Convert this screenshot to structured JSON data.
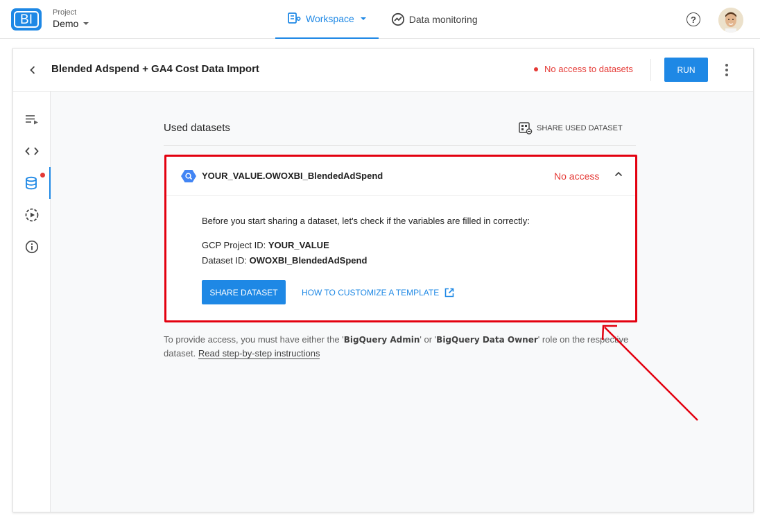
{
  "topbar": {
    "logo_text": "BI",
    "project_label": "Project",
    "project_name": "Demo",
    "nav": [
      {
        "label": "Workspace",
        "icon": "workspace-icon",
        "active": true
      },
      {
        "label": "Data monitoring",
        "icon": "monitoring-icon",
        "active": false
      }
    ],
    "help_icon": "help-circle-icon",
    "avatar": "user-avatar"
  },
  "pipeline": {
    "title": "Blended Adspend + GA4 Cost Data Import",
    "status": "No access to datasets",
    "run_label": "RUN"
  },
  "rail": {
    "items": [
      {
        "icon": "pipeline-list-icon"
      },
      {
        "icon": "code-icon"
      },
      {
        "icon": "database-icon",
        "active": true,
        "alert": true
      },
      {
        "icon": "schedule-run-icon"
      },
      {
        "icon": "info-icon"
      }
    ]
  },
  "datasets": {
    "section_title": "Used datasets",
    "share_used_label": "SHARE USED DATASET",
    "item": {
      "name": "YOUR_VALUE.OWOXBI_BlendedAdSpend",
      "access": "No access",
      "intro": "Before you start sharing a dataset, let's check if the variables are filled in correctly:",
      "project_id_label": "GCP Project ID:",
      "project_id_value": "YOUR_VALUE",
      "dataset_id_label": "Dataset ID:",
      "dataset_id_value": "OWOXBI_BlendedAdSpend",
      "share_button": "SHARE DATASET",
      "customize_link": "HOW TO CUSTOMIZE A TEMPLATE"
    },
    "note": {
      "prefix": "To provide access, you must have either the '",
      "role1": "BigQuery Admin",
      "mid": "' or '",
      "role2": "BigQuery Data Owner",
      "suffix": "' role on the respective dataset. ",
      "link": "Read step-by-step instructions"
    }
  },
  "colors": {
    "accent": "#1e88e5",
    "error": "#e53935",
    "highlight": "#e3000f"
  }
}
